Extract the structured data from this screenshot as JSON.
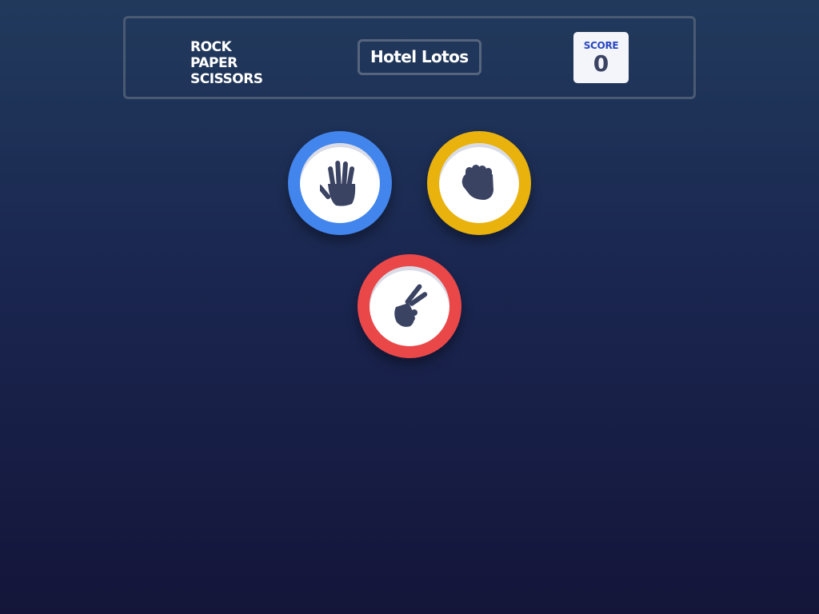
{
  "header": {
    "title_lines": [
      "ROCK",
      "PAPER",
      "SCISSORS"
    ],
    "player_name": "Hotel Lotos",
    "score": {
      "label": "SCORE",
      "value": "0"
    }
  },
  "choices": [
    {
      "name": "paper",
      "icon": "hand-open-icon",
      "ring_color": "#4285ec"
    },
    {
      "name": "rock",
      "icon": "fist-icon",
      "ring_color": "#e9b20c"
    },
    {
      "name": "scissors",
      "icon": "hand-peace-icon",
      "ring_color": "#ea4749"
    }
  ],
  "colors": {
    "background_top": "#213a5c",
    "background_bottom": "#141539",
    "icon_fill": "#3b4363",
    "score_label": "#2a46c0"
  }
}
